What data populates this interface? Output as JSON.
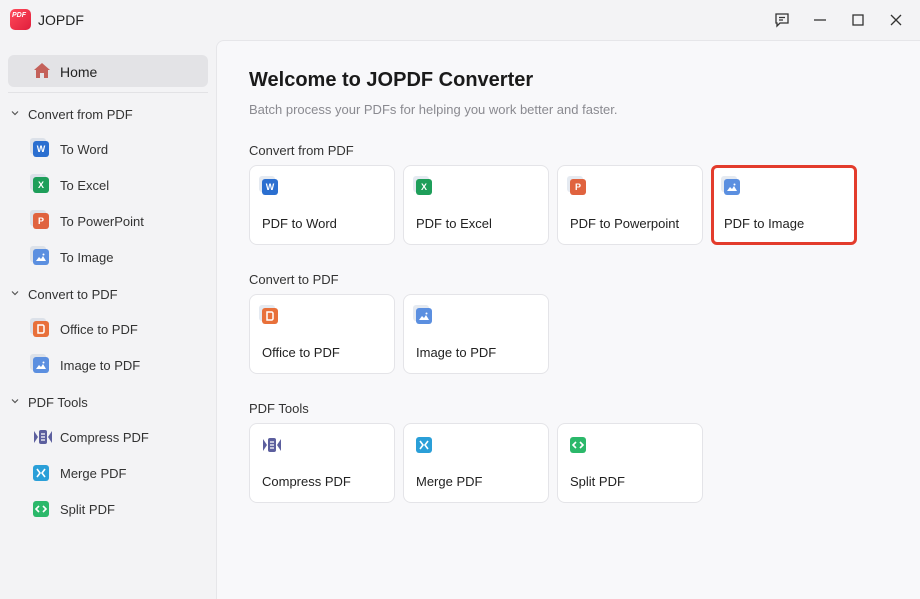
{
  "app": {
    "title": "JOPDF",
    "logo_text": "PDF"
  },
  "sidebar": {
    "home_label": "Home",
    "groups": [
      {
        "label": "Convert from PDF",
        "items": [
          {
            "label": "To Word",
            "icon": "word-icon"
          },
          {
            "label": "To Excel",
            "icon": "excel-icon"
          },
          {
            "label": "To PowerPoint",
            "icon": "powerpoint-icon"
          },
          {
            "label": "To Image",
            "icon": "image-icon"
          }
        ]
      },
      {
        "label": "Convert to PDF",
        "items": [
          {
            "label": "Office to PDF",
            "icon": "office-icon"
          },
          {
            "label": "Image to PDF",
            "icon": "image-icon"
          }
        ]
      },
      {
        "label": "PDF Tools",
        "items": [
          {
            "label": "Compress PDF",
            "icon": "compress-icon"
          },
          {
            "label": "Merge PDF",
            "icon": "merge-icon"
          },
          {
            "label": "Split PDF",
            "icon": "split-icon"
          }
        ]
      }
    ]
  },
  "main": {
    "title": "Welcome to JOPDF Converter",
    "subtitle": "Batch process your PDFs for helping you work better and faster.",
    "sections": [
      {
        "title": "Convert from PDF",
        "cards": [
          {
            "label": "PDF to Word",
            "icon": "word-icon"
          },
          {
            "label": "PDF to Excel",
            "icon": "excel-icon"
          },
          {
            "label": "PDF to Powerpoint",
            "icon": "powerpoint-icon"
          },
          {
            "label": "PDF to Image",
            "icon": "image-icon",
            "highlighted": true
          }
        ]
      },
      {
        "title": "Convert to PDF",
        "cards": [
          {
            "label": "Office to PDF",
            "icon": "office-icon"
          },
          {
            "label": "Image to PDF",
            "icon": "image-icon"
          }
        ]
      },
      {
        "title": "PDF Tools",
        "cards": [
          {
            "label": "Compress PDF",
            "icon": "compress-icon"
          },
          {
            "label": "Merge PDF",
            "icon": "merge-icon"
          },
          {
            "label": "Split PDF",
            "icon": "split-icon"
          }
        ]
      }
    ]
  },
  "colors": {
    "word": "#2b6fd0",
    "excel": "#1e9e5a",
    "powerpoint": "#e0633f",
    "image": "#5b8fe0",
    "office": "#e8703a",
    "compress": "#5c5f9e",
    "merge": "#2a9fd8",
    "split": "#2bb86a",
    "highlight": "#e33c2c"
  }
}
